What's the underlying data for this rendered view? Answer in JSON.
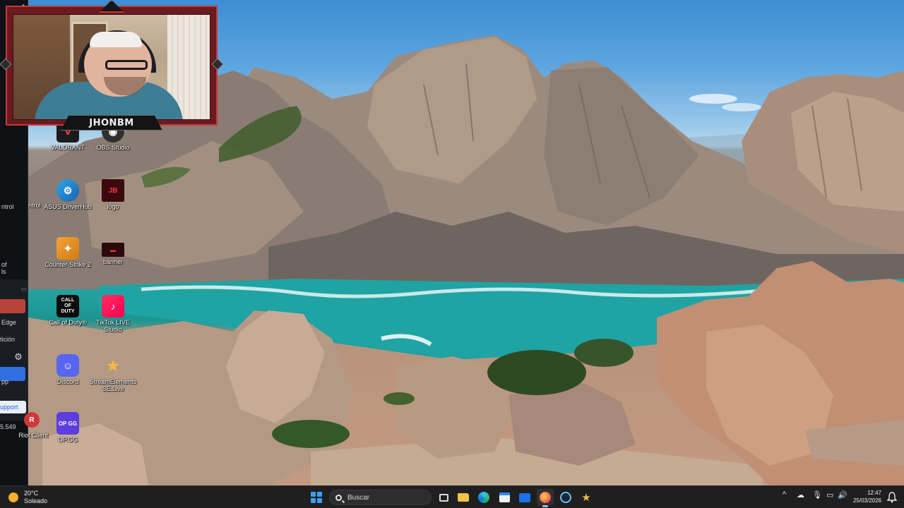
{
  "webcam": {
    "name": "JHONBM"
  },
  "left_strip": {
    "items": [
      {
        "text": "ntrol"
      },
      {
        "text": "of"
      },
      {
        "text": "ls"
      },
      {
        "text": "Edge"
      },
      {
        "text": "tición"
      },
      {
        "text": "pp"
      },
      {
        "text": "upport"
      },
      {
        "text": "5.549"
      }
    ]
  },
  "desktop": {
    "icons": [
      {
        "label": "VALORANT",
        "icon": "valorant-icon"
      },
      {
        "label": "OBS Studio",
        "icon": "obs-icon"
      },
      {
        "label": "ASUS DriverHub",
        "icon": "asus-driverhub-icon"
      },
      {
        "label": "logo",
        "icon": "logo-file-icon"
      },
      {
        "label": "Counter-Strike 2",
        "icon": "counter-strike-icon"
      },
      {
        "label": "banner",
        "icon": "banner-file-icon"
      },
      {
        "label": "Call of Duty®",
        "icon": "call-of-duty-icon",
        "glyph": "CALL OF DUTY"
      },
      {
        "label": "TikTok LIVE Studio",
        "icon": "tiktok-live-icon"
      },
      {
        "label": "Discord",
        "icon": "discord-icon"
      },
      {
        "label": "StreamElements SE.Live",
        "icon": "streamelements-icon"
      },
      {
        "label": "Riot Client",
        "icon": "riot-client-icon"
      },
      {
        "label": "OP.GG",
        "icon": "opgg-icon",
        "glyph": "OP GG"
      }
    ]
  },
  "taskbar": {
    "weather": {
      "temp": "20°C",
      "condition": "Soleado",
      "icon": "sun-icon"
    },
    "search_placeholder": "Buscar",
    "apps": [
      {
        "name": "task-view",
        "icon": "task-view-icon"
      },
      {
        "name": "file-explorer",
        "icon": "folder-icon"
      },
      {
        "name": "edge",
        "icon": "edge-icon"
      },
      {
        "name": "store",
        "icon": "store-icon"
      },
      {
        "name": "mail",
        "icon": "mail-icon"
      },
      {
        "name": "firefox",
        "icon": "firefox-icon",
        "active": true
      },
      {
        "name": "steam",
        "icon": "steam-icon"
      },
      {
        "name": "streamelements",
        "icon": "streamelements-icon"
      }
    ],
    "clock": {
      "time": "12:47",
      "date": "25/03/2026"
    },
    "colors": {
      "accent": "#3aa0ff",
      "bar": "#1f1f1f"
    }
  }
}
